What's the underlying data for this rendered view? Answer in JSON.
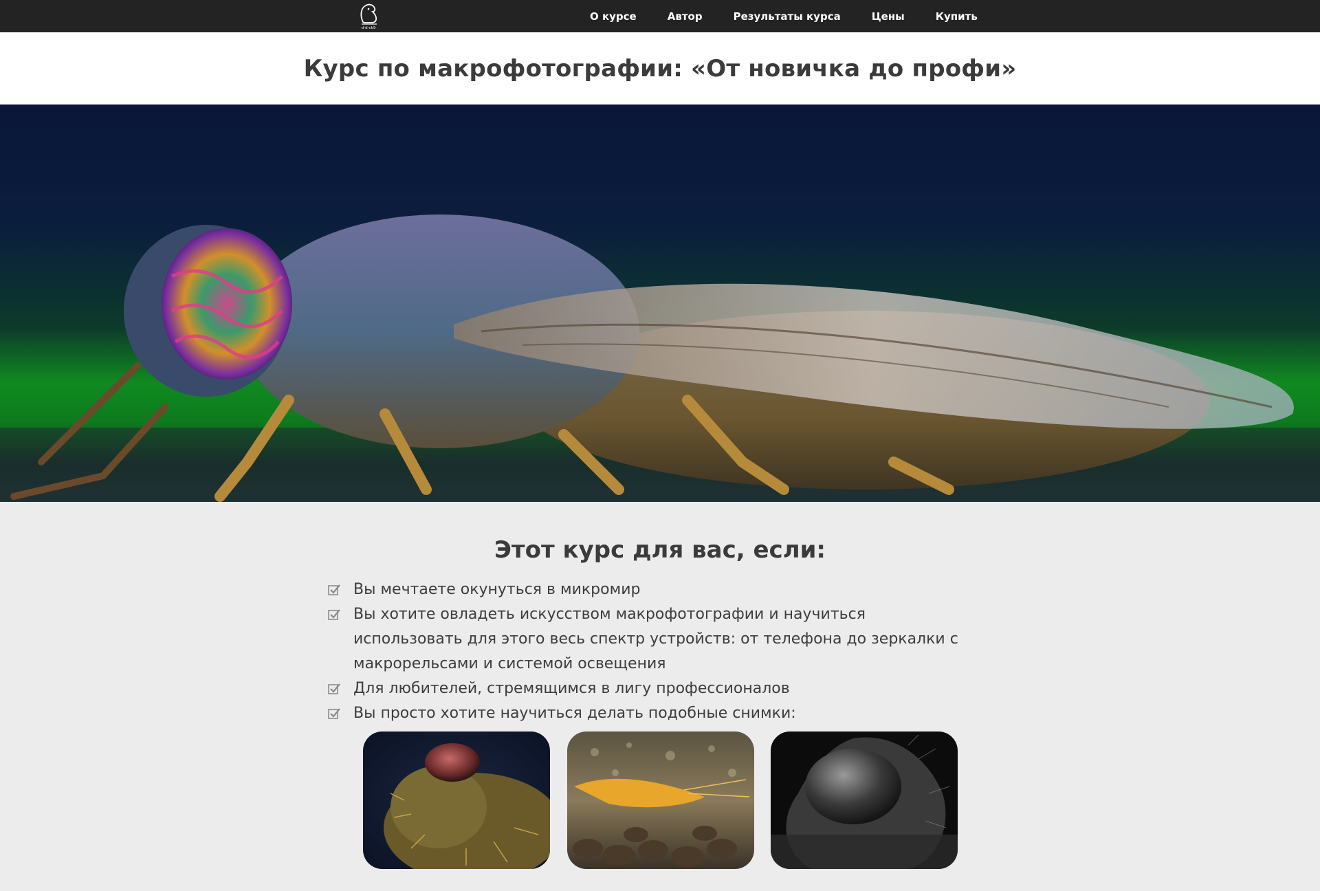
{
  "nav": {
    "logo_text": "d-d-ck9",
    "items": [
      {
        "label": "О курсе"
      },
      {
        "label": "Автор"
      },
      {
        "label": "Результаты курса"
      },
      {
        "label": "Цены"
      },
      {
        "label": "Купить"
      }
    ]
  },
  "title": "Курс по макрофотографии: «От новичка до профи»",
  "hero": {
    "image": "hero-horsefly-macro-photo"
  },
  "audience": {
    "heading": "Этот курс для вас, если:",
    "items": [
      {
        "text": "Вы мечтаете окунуться в микромир"
      },
      {
        "text": "Вы хотите овладеть искусством макрофотографии и научиться использовать для этого весь спектр устройств: от телефона до зеркалки с макрорельсами и системой освещения"
      },
      {
        "text": "Для любителей, стремящимся в лигу профессионалов"
      },
      {
        "text": "Вы просто хотите научиться делать подобные снимки:"
      }
    ]
  },
  "gallery": {
    "images": [
      "fly-head-macro-photo",
      "shrimp-macro-photo",
      "insect-head-bw-photo"
    ]
  },
  "colors": {
    "navbar": "#232323",
    "title_band": "#ffffff",
    "section_bg": "#ececec",
    "text": "#3b3b3b",
    "hero_green": "#108a20",
    "hero_navy": "#0a1638"
  }
}
